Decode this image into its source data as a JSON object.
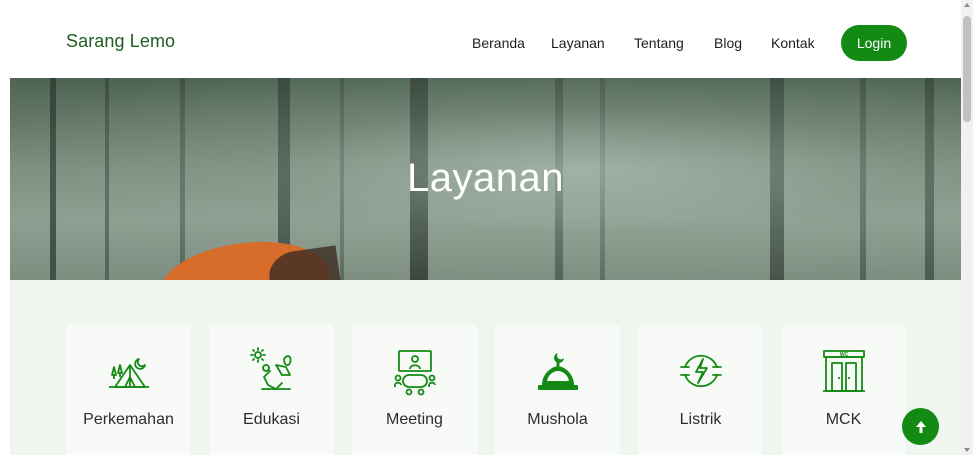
{
  "brand": "Sarang Lemo",
  "nav": {
    "items": [
      "Beranda",
      "Layanan",
      "Tentang",
      "Blog",
      "Kontak"
    ],
    "login_label": "Login"
  },
  "hero": {
    "title": "Layanan"
  },
  "services": [
    {
      "label": "Perkemahan",
      "icon": "camping-tent-icon"
    },
    {
      "label": "Edukasi",
      "icon": "education-icon"
    },
    {
      "label": "Meeting",
      "icon": "meeting-icon"
    },
    {
      "label": "Mushola",
      "icon": "mosque-dome-icon"
    },
    {
      "label": "Listrik",
      "icon": "electricity-plug-icon"
    },
    {
      "label": "MCK",
      "icon": "restroom-wc-icon"
    }
  ],
  "colors": {
    "accent": "#138a13",
    "brand_text": "#1f5d1f",
    "section_bg": "#eff6f0"
  },
  "scroll_top_icon": "arrow-up-icon"
}
